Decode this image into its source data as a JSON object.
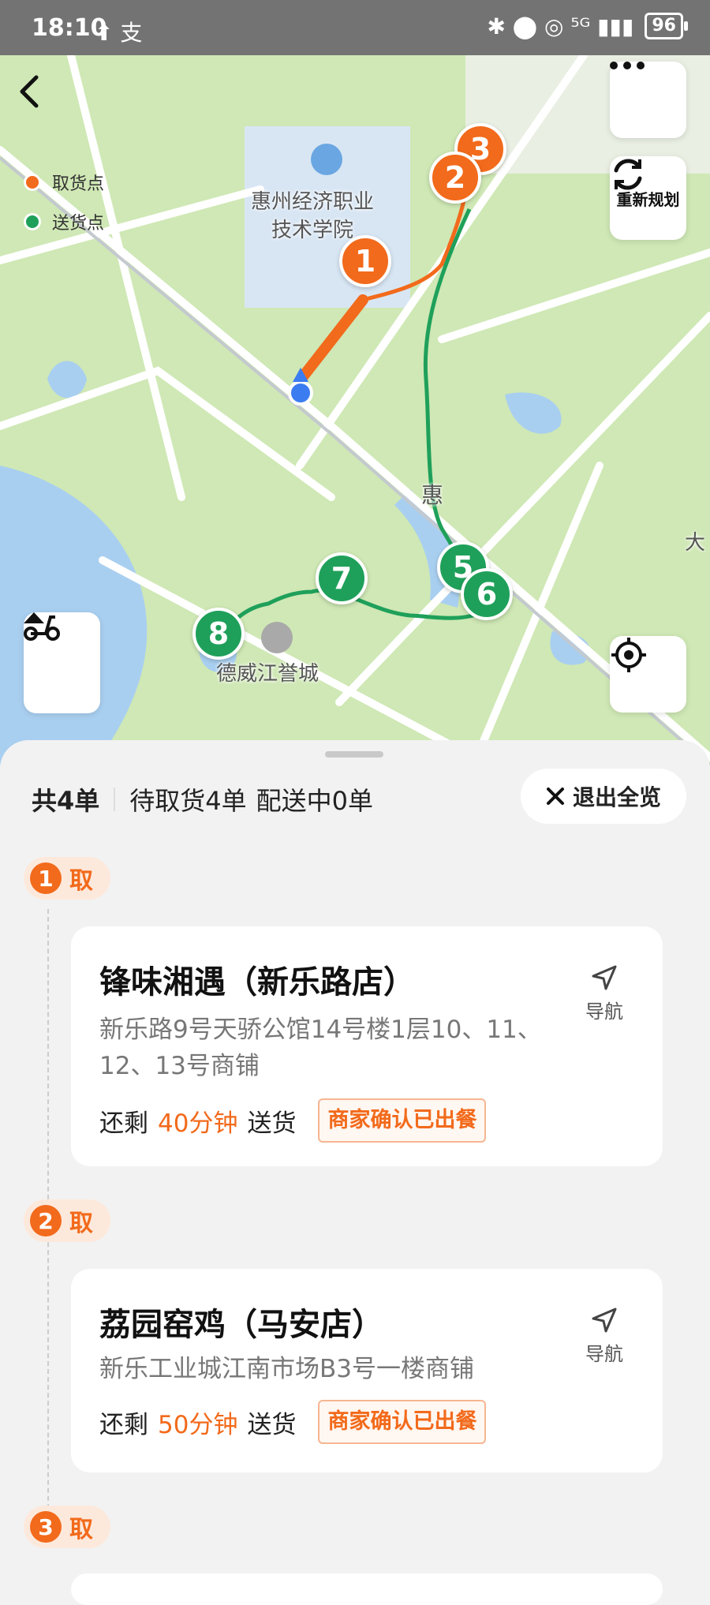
{
  "status_bar": {
    "time": "18:10",
    "left_icons": "⬆ 支",
    "right_icons": "✱ ⬤ ◎ ⁵ᴳ ▮▮▮",
    "battery": "96"
  },
  "map": {
    "legend": {
      "pickup_label": "取货点",
      "delivery_label": "送货点",
      "pickup_color": "#f26a1b",
      "delivery_color": "#1fa05a"
    },
    "labels": {
      "school": "惠州经济职业\n技术学院",
      "community": "德威江誉城",
      "road": "惠",
      "edge": "大"
    },
    "pickup_pins": [
      "1",
      "2",
      "3"
    ],
    "delivery_pins": [
      "5",
      "6",
      "7",
      "8"
    ],
    "replan_label": "重新规划"
  },
  "summary": {
    "total": "共4单",
    "pending_pickup": "待取货4单",
    "delivering": "配送中0单",
    "exit_label": "退出全览"
  },
  "orders": [
    {
      "step_num": "1",
      "step_label": "取",
      "name": "锋味湘遇（新乐路店）",
      "address": "新乐路9号天骄公馆14号楼1层10、11、12、13号商铺",
      "remain_prefix": "还剩",
      "remain_minutes": "40分钟",
      "remain_suffix": "送货",
      "badge": "商家确认已出餐",
      "nav_label": "导航"
    },
    {
      "step_num": "2",
      "step_label": "取",
      "name": "荔园窑鸡（马安店）",
      "address": "新乐工业城江南市场B3号一楼商铺",
      "remain_prefix": "还剩",
      "remain_minutes": "50分钟",
      "remain_suffix": "送货",
      "badge": "商家确认已出餐",
      "nav_label": "导航"
    },
    {
      "step_num": "3",
      "step_label": "取"
    }
  ]
}
